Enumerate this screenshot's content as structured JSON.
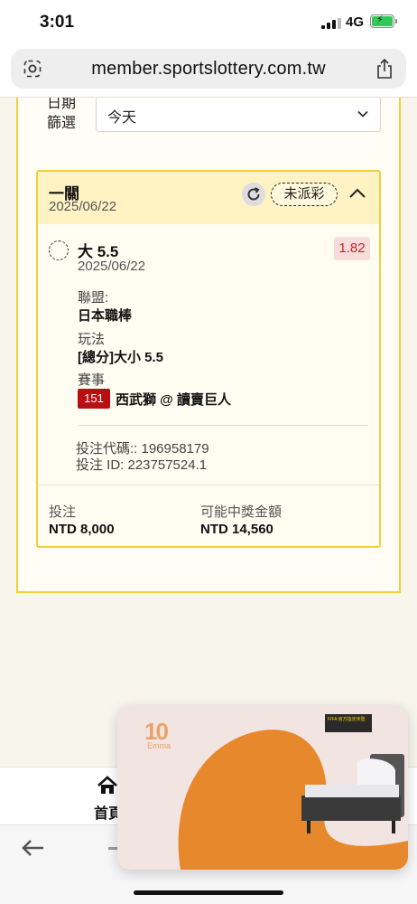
{
  "status_bar": {
    "time": "3:01",
    "network": "4G"
  },
  "browser": {
    "url": "member.sportslottery.com.tw"
  },
  "filter": {
    "label": "日期篩選",
    "value": "今天"
  },
  "bet": {
    "type": "一關",
    "date": "2025/06/22",
    "status": "未派彩",
    "selection": {
      "name": "大 5.5",
      "date": "2025/06/22",
      "odds": "1.82"
    },
    "league_label": "聯盟:",
    "league": "日本職棒",
    "play_label": "玩法",
    "play": "[總分]大小 5.5",
    "event_label": "賽事",
    "event_number": "151",
    "event_name": "西武獅 @ 讀賣巨人",
    "bet_code": "投注代碼:: 196958179",
    "bet_id": "投注 ID: 223757524.1",
    "stake_label": "投注",
    "stake": "NTD 8,000",
    "payout_label": "可能中獎金額",
    "payout": "NTD 14,560"
  },
  "nav": {
    "home_label": "首頁"
  },
  "ad": {
    "brand_number": "10",
    "brand_name": "Emma",
    "tag_text": "FIFA 官方指定床墊"
  },
  "colors": {
    "accent_border": "#f2cf3a",
    "header_bg": "#fff3c4",
    "odds_text": "#c0272d",
    "event_badge": "#b80f12",
    "ad_orange": "#e8882c"
  }
}
